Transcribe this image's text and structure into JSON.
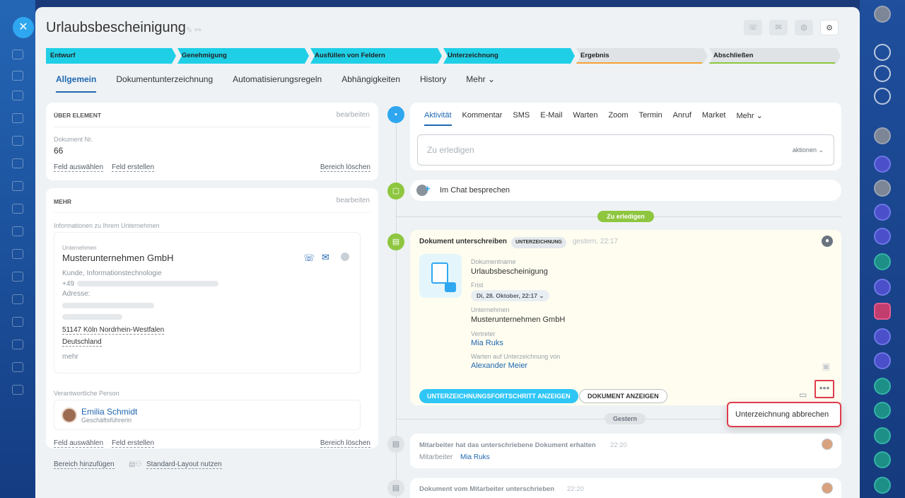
{
  "title": "Urlaubsbescheinigung",
  "stages": [
    {
      "label": "Entwurf",
      "state": "done",
      "width": 184
    },
    {
      "label": "Genehmigung",
      "state": "done",
      "width": 186
    },
    {
      "label": "Ausfüllen von Feldern",
      "state": "done",
      "width": 186
    },
    {
      "label": "Unterzeichnung",
      "state": "done",
      "width": 186
    },
    {
      "label": "Ergebnis",
      "state": "orange",
      "width": 186
    },
    {
      "label": "Abschließen",
      "state": "green",
      "width": 186
    }
  ],
  "tabs": [
    "Allgemein",
    "Dokumentunterzeichnung",
    "Automatisierungsregeln",
    "Abhängigkeiten",
    "History",
    "Mehr ⌄"
  ],
  "about": {
    "header": "Über Element",
    "edit": "bearbeiten",
    "doc_label": "Dokument Nr.",
    "doc_value": "66",
    "select_field": "Feld auswählen",
    "create_field": "Feld erstellen",
    "delete_area": "Bereich löschen"
  },
  "more": {
    "header": "Mehr",
    "edit": "bearbeiten",
    "company_info_label": "Informationen zu Ihrem Unternehmen",
    "company_label": "Unternehmen",
    "company_name": "Musterunternehmen GmbH",
    "company_type": "Kunde, Informationstechnologie",
    "phone_prefix": "+49",
    "address_label": "Adresse:",
    "city": "51147 Köln Nordrhein-Westfalen",
    "country": "Deutschland",
    "more_link": "mehr",
    "responsible_label": "Verantwortliche Person",
    "person_name": "Emilia Schmidt",
    "person_role": "Geschäftsführerin",
    "select_field": "Feld auswählen",
    "create_field": "Feld erstellen",
    "delete_area": "Bereich löschen"
  },
  "footer": {
    "add_area": "Bereich hinzufügen",
    "default_layout": "Standard-Layout nutzen"
  },
  "activity": {
    "tabs": [
      "Aktivität",
      "Kommentar",
      "SMS",
      "E-Mail",
      "Warten",
      "Zoom",
      "Termin",
      "Anruf",
      "Market",
      "Mehr ⌄"
    ],
    "todo_placeholder": "Zu erledigen",
    "actions": "aktionen ⌄",
    "chat": "Im Chat besprechen",
    "todo_badge": "Zu erledigen"
  },
  "document": {
    "title": "Dokument unterschreiben",
    "badge": "UNTERZEICHNUNG",
    "time": "gestern, 22:17",
    "name_label": "Dokumentname",
    "name_value": "Urlaubsbescheinigung",
    "deadline_label": "Frist",
    "deadline_value": "Di, 28. Oktober, 22:17 ⌄",
    "company_label": "Unternehmen",
    "company_value": "Musterunternehmen GmbH",
    "rep_label": "Vertreter",
    "rep_value": "Mia Ruks",
    "waiting_label": "Warten auf Unterzeichnung von",
    "waiting_value": "Alexander Meier",
    "progress_btn": "UNTERZEICHNUNGSFORTSCHRITT ANZEIGEN",
    "show_btn": "DOKUMENT ANZEIGEN",
    "more_glyph": "•••"
  },
  "menu": {
    "cancel_signing": "Unterzeichnung abbrechen"
  },
  "yesterday_badge": "Gestern",
  "history": [
    {
      "text": "Mitarbeiter hat das unterschriebene Dokument erhalten",
      "time": "22:20",
      "sub_label": "Mitarbeiter",
      "sub_value": "Mia Ruks"
    },
    {
      "text": "Dokument vom Mitarbeiter unterschrieben",
      "time": "22:20"
    }
  ],
  "colors": {
    "accent": "#2067b0",
    "stage_done": "#1fcfe6",
    "green": "#8ec63f",
    "highlight": "#e03b4d",
    "doc_bg": "#fefdf0"
  }
}
